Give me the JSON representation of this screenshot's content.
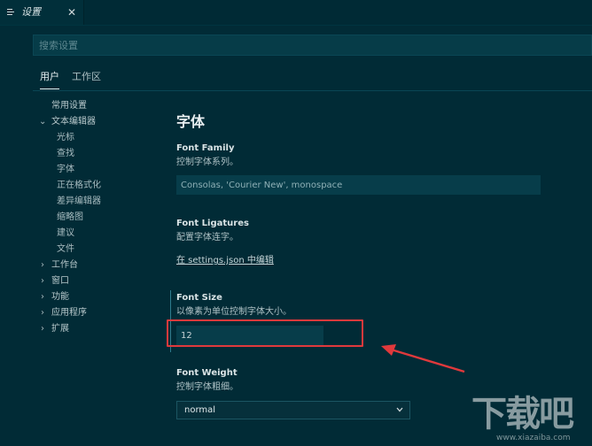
{
  "tab": {
    "title": "设置",
    "icon": "settings-editor-icon",
    "close_glyph": "✕"
  },
  "search": {
    "placeholder": "搜索设置",
    "value": ""
  },
  "scope_tabs": {
    "user": "用户",
    "workspace": "工作区"
  },
  "tree": {
    "common": "常用设置",
    "text_editor": "文本编辑器",
    "text_editor_children": [
      "光标",
      "查找",
      "字体",
      "正在格式化",
      "差异编辑器",
      "缩略图",
      "建议",
      "文件"
    ],
    "collapsed": [
      "工作台",
      "窗口",
      "功能",
      "应用程序",
      "扩展"
    ]
  },
  "content": {
    "section_title": "字体",
    "font_family": {
      "title": "Font Family",
      "desc": "控制字体系列。",
      "value": "Consolas, 'Courier New', monospace"
    },
    "font_ligatures": {
      "title": "Font Ligatures",
      "desc": "配置字体连字。",
      "link": "在 settings.json 中编辑"
    },
    "font_size": {
      "title": "Font Size",
      "desc": "以像素为单位控制字体大小。",
      "value": "12"
    },
    "font_weight": {
      "title": "Font Weight",
      "desc": "控制字体粗细。",
      "value": "normal"
    }
  },
  "annotation": {
    "box_color": "#e0393c",
    "arrow_color": "#e0393c"
  },
  "watermark": {
    "logo": "下载吧",
    "url": "www.xiazaiba.com"
  },
  "colors": {
    "background": "#012b36",
    "input": "#073d4a",
    "accent": "#2d7c8e"
  }
}
